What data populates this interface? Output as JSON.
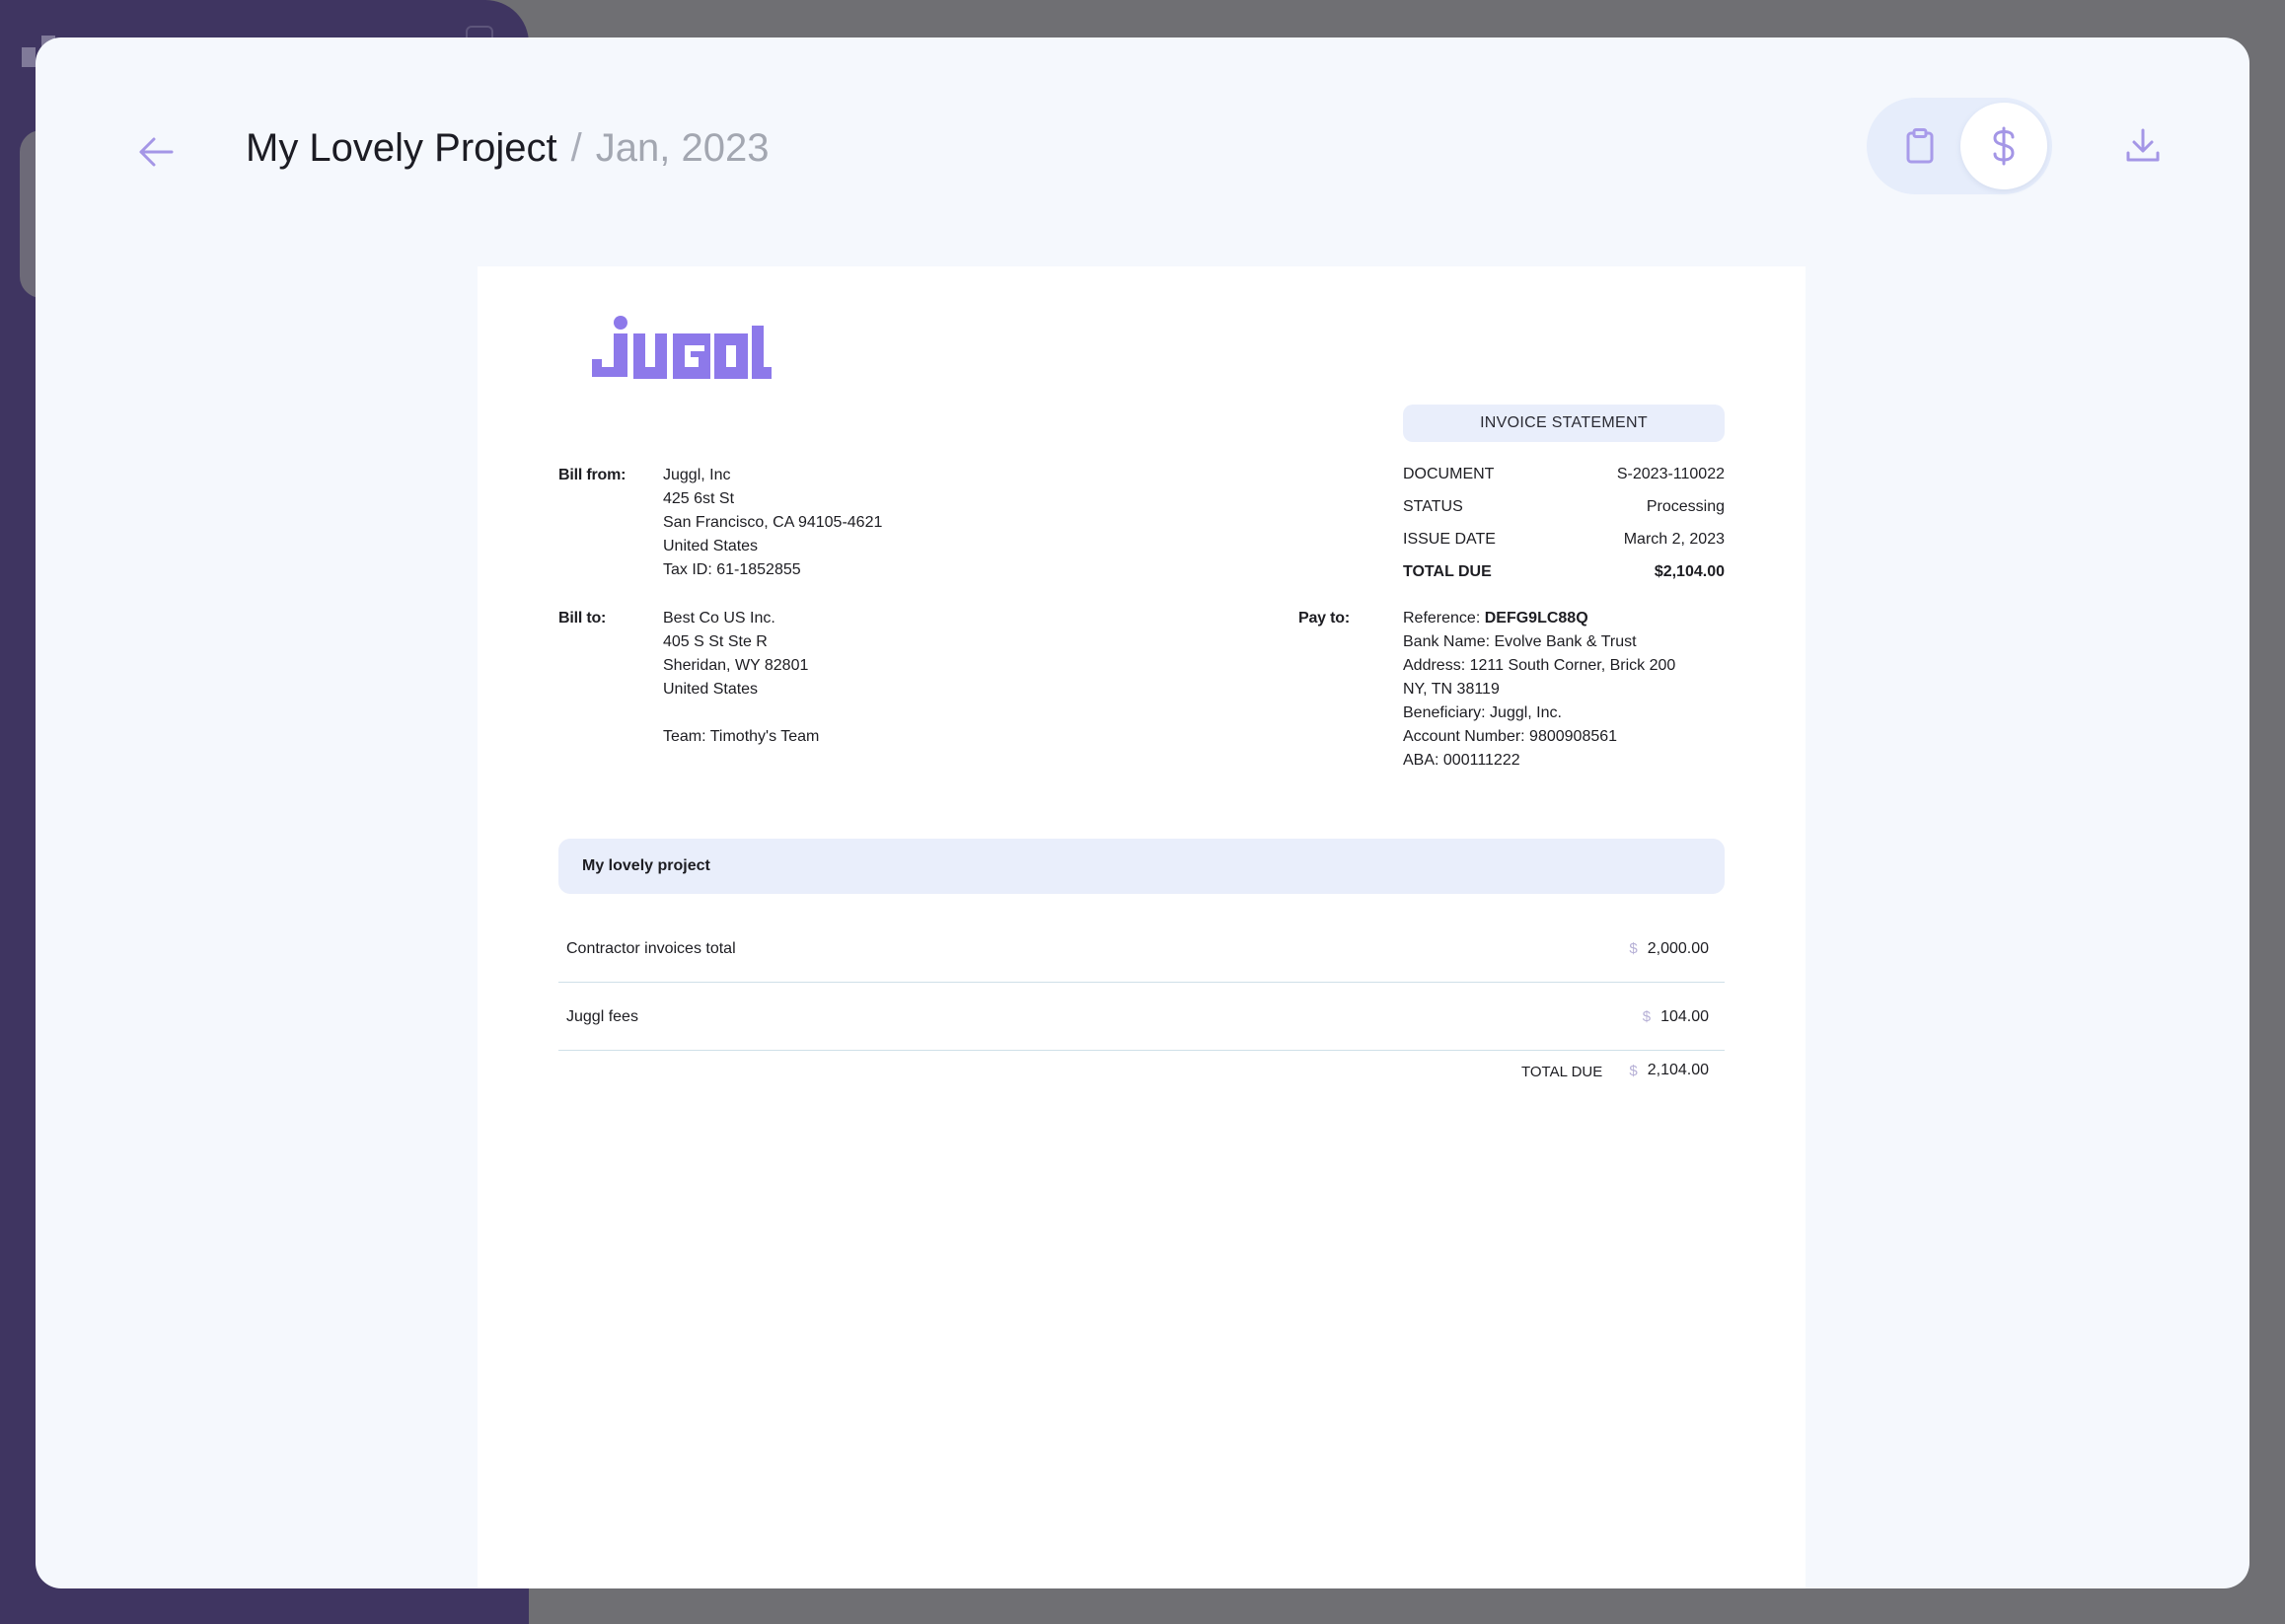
{
  "header": {
    "project_title": "My Lovely Project",
    "separator": "/",
    "period": "Jan, 2023"
  },
  "icons": {
    "back": "arrow-left-icon",
    "clipboard": "clipboard-icon",
    "dollar": "dollar-icon",
    "download": "download-icon"
  },
  "colors": {
    "accent": "#a496e6",
    "logo": "#8d79ea",
    "badge_bg": "#e9eefb"
  },
  "invoice": {
    "logo_text": "JUGGL",
    "badge": "INVOICE STATEMENT",
    "bill_from_label": "Bill from:",
    "bill_from": [
      "Juggl, Inc",
      "425 6st St",
      "San Francisco, CA 94105-4621",
      "United States",
      "Tax ID: 61-1852855"
    ],
    "bill_to_label": "Bill to:",
    "bill_to": [
      "Best Co US Inc.",
      "405 S St Ste R",
      "Sheridan, WY 82801",
      "United States"
    ],
    "team": "Team: Timothy's Team",
    "pay_to_label": "Pay to:",
    "pay_to": {
      "reference_label": "Reference: ",
      "reference_value": "DEFG9LC88Q",
      "lines": [
        "Bank Name: Evolve Bank & Trust",
        "Address: 1211 South Corner, Brick 200",
        "NY, TN 38119",
        "Beneficiary: Juggl, Inc.",
        "Account Number: 9800908561",
        "ABA: 000111222"
      ]
    },
    "meta": [
      {
        "label": "DOCUMENT",
        "value": "S-2023-110022"
      },
      {
        "label": "STATUS",
        "value": "Processing"
      },
      {
        "label": "ISSUE DATE",
        "value": "March 2, 2023"
      },
      {
        "label": "TOTAL DUE",
        "value": "$2,104.00"
      }
    ],
    "project_name": "My lovely project",
    "currency_symbol": "$",
    "items": [
      {
        "label": "Contractor invoices total",
        "amount": "2,000.00"
      },
      {
        "label": "Juggl fees",
        "amount": "104.00"
      }
    ],
    "total_label": "TOTAL DUE",
    "total_amount": "2,104.00"
  }
}
